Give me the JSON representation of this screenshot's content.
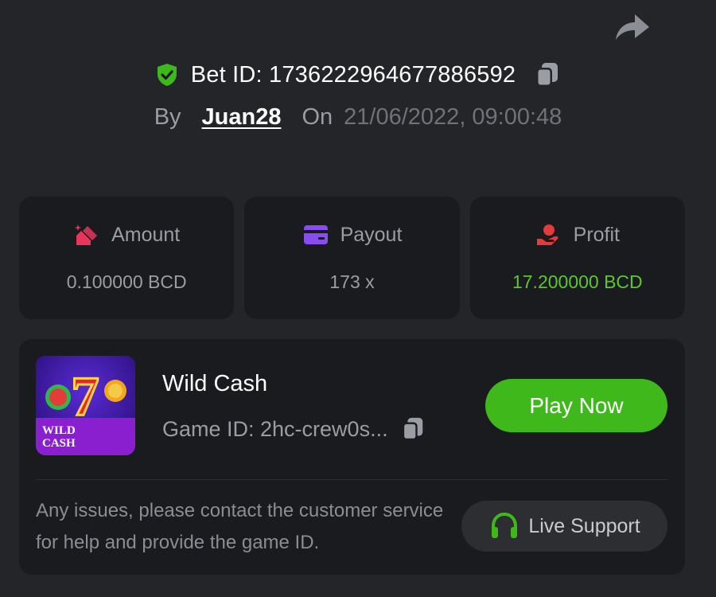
{
  "header": {
    "bet_id": "Bet ID: 1736222964677886592",
    "by_label": "By",
    "username": "Juan28",
    "on_label": "On",
    "datetime": "21/06/2022, 09:00:48"
  },
  "stats": [
    {
      "label": "Amount",
      "value": "0.100000 BCD",
      "icon": "bet-chips-icon",
      "color": "#e8365b"
    },
    {
      "label": "Payout",
      "value": "173 x",
      "icon": "card-icon",
      "color": "#8a4cf2"
    },
    {
      "label": "Profit",
      "value": "17.200000 BCD",
      "icon": "hand-coin-icon",
      "color": "#e33a3a",
      "value_color": "#5cc72c"
    }
  ],
  "game": {
    "name": "Wild Cash",
    "game_id": "Game ID: 2hc-crew0s...",
    "thumbnail_text": "WILD CASH",
    "play_label": "Play Now"
  },
  "support": {
    "notice": "Any issues, please contact the customer service for help and provide the game ID.",
    "button_label": "Live Support"
  },
  "colors": {
    "background": "#232528",
    "card": "#1a1b1e",
    "accent_green": "#3fb81b",
    "profit_green": "#5cc72c"
  }
}
